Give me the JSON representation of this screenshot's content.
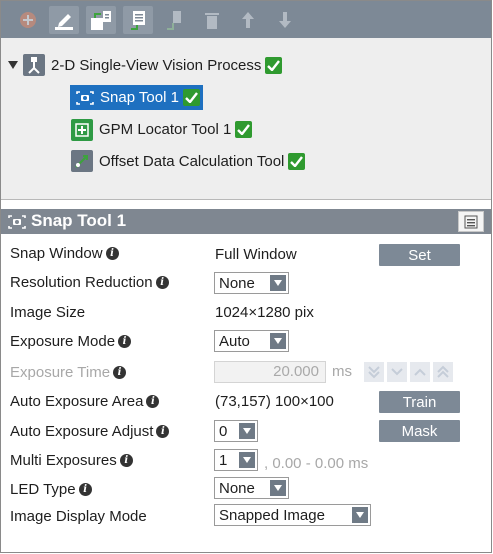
{
  "colors": {
    "toolbar_bg": "#7d8996",
    "selection": "#1e70c0",
    "checkmark": "#2f9a2f",
    "header_bg": "#7f8791",
    "button_bg": "#7d8996"
  },
  "toolbar": {
    "buttons": [
      {
        "icon": "add-icon",
        "enabled": false
      },
      {
        "icon": "rename-icon",
        "enabled": true
      },
      {
        "icon": "add-tool-icon",
        "enabled": true
      },
      {
        "icon": "paste-tool-icon",
        "enabled": true
      },
      {
        "icon": "insert-tool-icon",
        "enabled": false
      },
      {
        "icon": "delete-icon",
        "enabled": false
      },
      {
        "icon": "move-up-icon",
        "enabled": false
      },
      {
        "icon": "move-down-icon",
        "enabled": false
      }
    ]
  },
  "tree": {
    "root": {
      "label": "2-D Single-View Vision Process",
      "valid": true,
      "expanded": true
    },
    "children": [
      {
        "label": "Snap Tool 1",
        "icon": "camera-snap-icon",
        "valid": true,
        "selected": true
      },
      {
        "label": "GPM Locator Tool 1",
        "icon": "gpm-locator-icon",
        "valid": true
      },
      {
        "label": "Offset Data Calculation Tool",
        "icon": "offset-calc-icon",
        "valid": true
      }
    ]
  },
  "panel": {
    "title": "Snap Tool 1",
    "icon": "camera-snap-icon"
  },
  "properties": {
    "snap_window": {
      "label": "Snap Window",
      "value": "Full Window",
      "button": "Set"
    },
    "resolution_reduction": {
      "label": "Resolution Reduction",
      "value": "None"
    },
    "image_size": {
      "label": "Image Size",
      "value": "1024×1280 pix"
    },
    "exposure_mode": {
      "label": "Exposure Mode",
      "value": "Auto"
    },
    "exposure_time": {
      "label": "Exposure Time",
      "value": "20.000",
      "unit": "ms",
      "enabled": false
    },
    "auto_exposure_area": {
      "label": "Auto Exposure Area",
      "value": "(73,157) 100×100",
      "button": "Train"
    },
    "auto_exposure_adjust": {
      "label": "Auto Exposure Adjust",
      "value": "0",
      "button": "Mask"
    },
    "multi_exposures": {
      "label": "Multi Exposures",
      "value": "1",
      "range": ", 0.00 - 0.00 ms"
    },
    "led_type": {
      "label": "LED Type",
      "value": "None"
    },
    "image_display_mode": {
      "label": "Image Display Mode",
      "value": "Snapped Image"
    }
  }
}
